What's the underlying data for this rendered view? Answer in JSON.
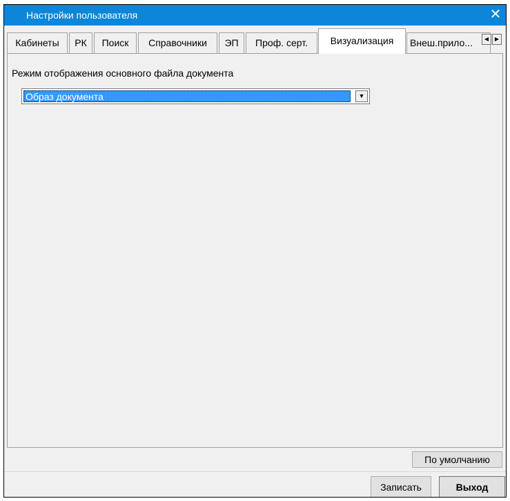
{
  "window": {
    "title": "Настройки пользователя",
    "close_symbol": "✕"
  },
  "tabs": [
    {
      "label": "Кабинеты",
      "active": false
    },
    {
      "label": "РК",
      "active": false
    },
    {
      "label": "Поиск",
      "active": false
    },
    {
      "label": "Справочники",
      "active": false
    },
    {
      "label": "ЭП",
      "active": false
    },
    {
      "label": "Проф. серт.",
      "active": false
    },
    {
      "label": "Визуализация",
      "active": true
    },
    {
      "label": "Внеш.прило...",
      "active": false
    }
  ],
  "tab_scroll": {
    "left_symbol": "◀",
    "right_symbol": "▶"
  },
  "panel": {
    "field_label": "Режим отображения основного файла документа",
    "display_mode": {
      "selected": "Образ документа",
      "arrow_symbol": "▼"
    }
  },
  "buttons": {
    "default_label": "По умолчанию",
    "save_label": "Записать",
    "exit_label": "Выход"
  },
  "colors": {
    "titlebar": "#0c86d8",
    "selection": "#3399ff",
    "dialog_bg": "#f0f0f0"
  }
}
